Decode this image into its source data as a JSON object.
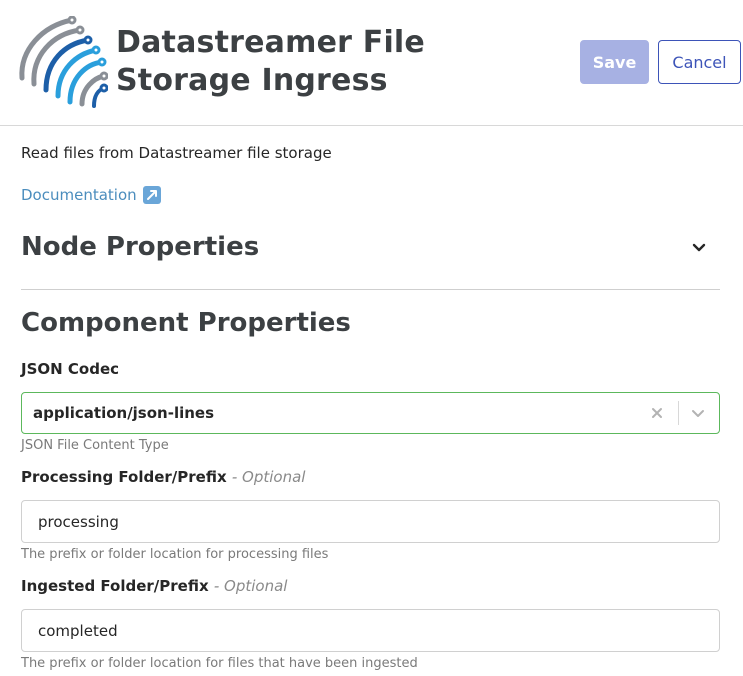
{
  "header": {
    "title": "Datastreamer File Storage Ingress",
    "save_label": "Save",
    "cancel_label": "Cancel",
    "colors": {
      "save_bg": "#a7b1e3",
      "cancel_border": "#3d54b8"
    }
  },
  "description": "Read files from Datastreamer file storage",
  "documentation": {
    "label": "Documentation",
    "icon": "external-link-icon"
  },
  "node_properties": {
    "heading": "Node Properties",
    "icon": "chevron-down-icon"
  },
  "component_properties": {
    "heading": "Component Properties",
    "json_codec": {
      "label": "JSON Codec",
      "value": "application/json-lines",
      "help": "JSON File Content Type"
    },
    "processing_folder": {
      "label": "Processing Folder/Prefix",
      "optional": "- Optional",
      "value": "processing",
      "help": "The prefix or folder location for processing files"
    },
    "ingested_folder": {
      "label": "Ingested Folder/Prefix",
      "optional": "- Optional",
      "value": "completed",
      "help": "The prefix or folder location for files that have been ingested"
    }
  }
}
